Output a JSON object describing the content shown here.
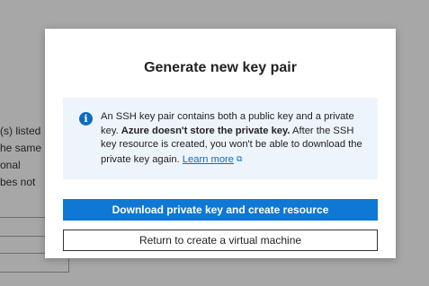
{
  "background": {
    "text_lines": [
      "(s) listed",
      "he same",
      "onal",
      "bes not"
    ]
  },
  "dialog": {
    "title": "Generate new key pair",
    "info": {
      "icon": "info-icon",
      "text_start": "An SSH key pair contains both a public key and a private key. ",
      "text_bold": "Azure doesn't store the private key.",
      "text_end": " After the SSH key resource is created, you won't be able to download the private key again. ",
      "link_label": "Learn more",
      "link_icon": "external-link-icon"
    },
    "primary_button_label": "Download private key and create resource",
    "secondary_button_label": "Return to create a virtual machine"
  },
  "colors": {
    "accent": "#0f78d4",
    "info_background": "#eef4fc",
    "overlay": "#a7a7a7"
  }
}
